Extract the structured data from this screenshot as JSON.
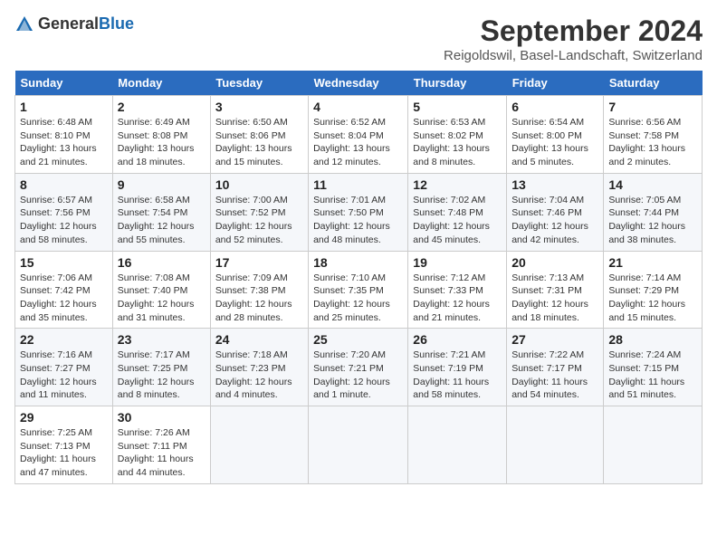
{
  "header": {
    "logo_general": "General",
    "logo_blue": "Blue",
    "title": "September 2024",
    "location": "Reigoldswil, Basel-Landschaft, Switzerland"
  },
  "weekdays": [
    "Sunday",
    "Monday",
    "Tuesday",
    "Wednesday",
    "Thursday",
    "Friday",
    "Saturday"
  ],
  "weeks": [
    [
      {
        "day": "1",
        "info": "Sunrise: 6:48 AM\nSunset: 8:10 PM\nDaylight: 13 hours\nand 21 minutes."
      },
      {
        "day": "2",
        "info": "Sunrise: 6:49 AM\nSunset: 8:08 PM\nDaylight: 13 hours\nand 18 minutes."
      },
      {
        "day": "3",
        "info": "Sunrise: 6:50 AM\nSunset: 8:06 PM\nDaylight: 13 hours\nand 15 minutes."
      },
      {
        "day": "4",
        "info": "Sunrise: 6:52 AM\nSunset: 8:04 PM\nDaylight: 13 hours\nand 12 minutes."
      },
      {
        "day": "5",
        "info": "Sunrise: 6:53 AM\nSunset: 8:02 PM\nDaylight: 13 hours\nand 8 minutes."
      },
      {
        "day": "6",
        "info": "Sunrise: 6:54 AM\nSunset: 8:00 PM\nDaylight: 13 hours\nand 5 minutes."
      },
      {
        "day": "7",
        "info": "Sunrise: 6:56 AM\nSunset: 7:58 PM\nDaylight: 13 hours\nand 2 minutes."
      }
    ],
    [
      {
        "day": "8",
        "info": "Sunrise: 6:57 AM\nSunset: 7:56 PM\nDaylight: 12 hours\nand 58 minutes."
      },
      {
        "day": "9",
        "info": "Sunrise: 6:58 AM\nSunset: 7:54 PM\nDaylight: 12 hours\nand 55 minutes."
      },
      {
        "day": "10",
        "info": "Sunrise: 7:00 AM\nSunset: 7:52 PM\nDaylight: 12 hours\nand 52 minutes."
      },
      {
        "day": "11",
        "info": "Sunrise: 7:01 AM\nSunset: 7:50 PM\nDaylight: 12 hours\nand 48 minutes."
      },
      {
        "day": "12",
        "info": "Sunrise: 7:02 AM\nSunset: 7:48 PM\nDaylight: 12 hours\nand 45 minutes."
      },
      {
        "day": "13",
        "info": "Sunrise: 7:04 AM\nSunset: 7:46 PM\nDaylight: 12 hours\nand 42 minutes."
      },
      {
        "day": "14",
        "info": "Sunrise: 7:05 AM\nSunset: 7:44 PM\nDaylight: 12 hours\nand 38 minutes."
      }
    ],
    [
      {
        "day": "15",
        "info": "Sunrise: 7:06 AM\nSunset: 7:42 PM\nDaylight: 12 hours\nand 35 minutes."
      },
      {
        "day": "16",
        "info": "Sunrise: 7:08 AM\nSunset: 7:40 PM\nDaylight: 12 hours\nand 31 minutes."
      },
      {
        "day": "17",
        "info": "Sunrise: 7:09 AM\nSunset: 7:38 PM\nDaylight: 12 hours\nand 28 minutes."
      },
      {
        "day": "18",
        "info": "Sunrise: 7:10 AM\nSunset: 7:35 PM\nDaylight: 12 hours\nand 25 minutes."
      },
      {
        "day": "19",
        "info": "Sunrise: 7:12 AM\nSunset: 7:33 PM\nDaylight: 12 hours\nand 21 minutes."
      },
      {
        "day": "20",
        "info": "Sunrise: 7:13 AM\nSunset: 7:31 PM\nDaylight: 12 hours\nand 18 minutes."
      },
      {
        "day": "21",
        "info": "Sunrise: 7:14 AM\nSunset: 7:29 PM\nDaylight: 12 hours\nand 15 minutes."
      }
    ],
    [
      {
        "day": "22",
        "info": "Sunrise: 7:16 AM\nSunset: 7:27 PM\nDaylight: 12 hours\nand 11 minutes."
      },
      {
        "day": "23",
        "info": "Sunrise: 7:17 AM\nSunset: 7:25 PM\nDaylight: 12 hours\nand 8 minutes."
      },
      {
        "day": "24",
        "info": "Sunrise: 7:18 AM\nSunset: 7:23 PM\nDaylight: 12 hours\nand 4 minutes."
      },
      {
        "day": "25",
        "info": "Sunrise: 7:20 AM\nSunset: 7:21 PM\nDaylight: 12 hours\nand 1 minute."
      },
      {
        "day": "26",
        "info": "Sunrise: 7:21 AM\nSunset: 7:19 PM\nDaylight: 11 hours\nand 58 minutes."
      },
      {
        "day": "27",
        "info": "Sunrise: 7:22 AM\nSunset: 7:17 PM\nDaylight: 11 hours\nand 54 minutes."
      },
      {
        "day": "28",
        "info": "Sunrise: 7:24 AM\nSunset: 7:15 PM\nDaylight: 11 hours\nand 51 minutes."
      }
    ],
    [
      {
        "day": "29",
        "info": "Sunrise: 7:25 AM\nSunset: 7:13 PM\nDaylight: 11 hours\nand 47 minutes."
      },
      {
        "day": "30",
        "info": "Sunrise: 7:26 AM\nSunset: 7:11 PM\nDaylight: 11 hours\nand 44 minutes."
      },
      null,
      null,
      null,
      null,
      null
    ]
  ]
}
